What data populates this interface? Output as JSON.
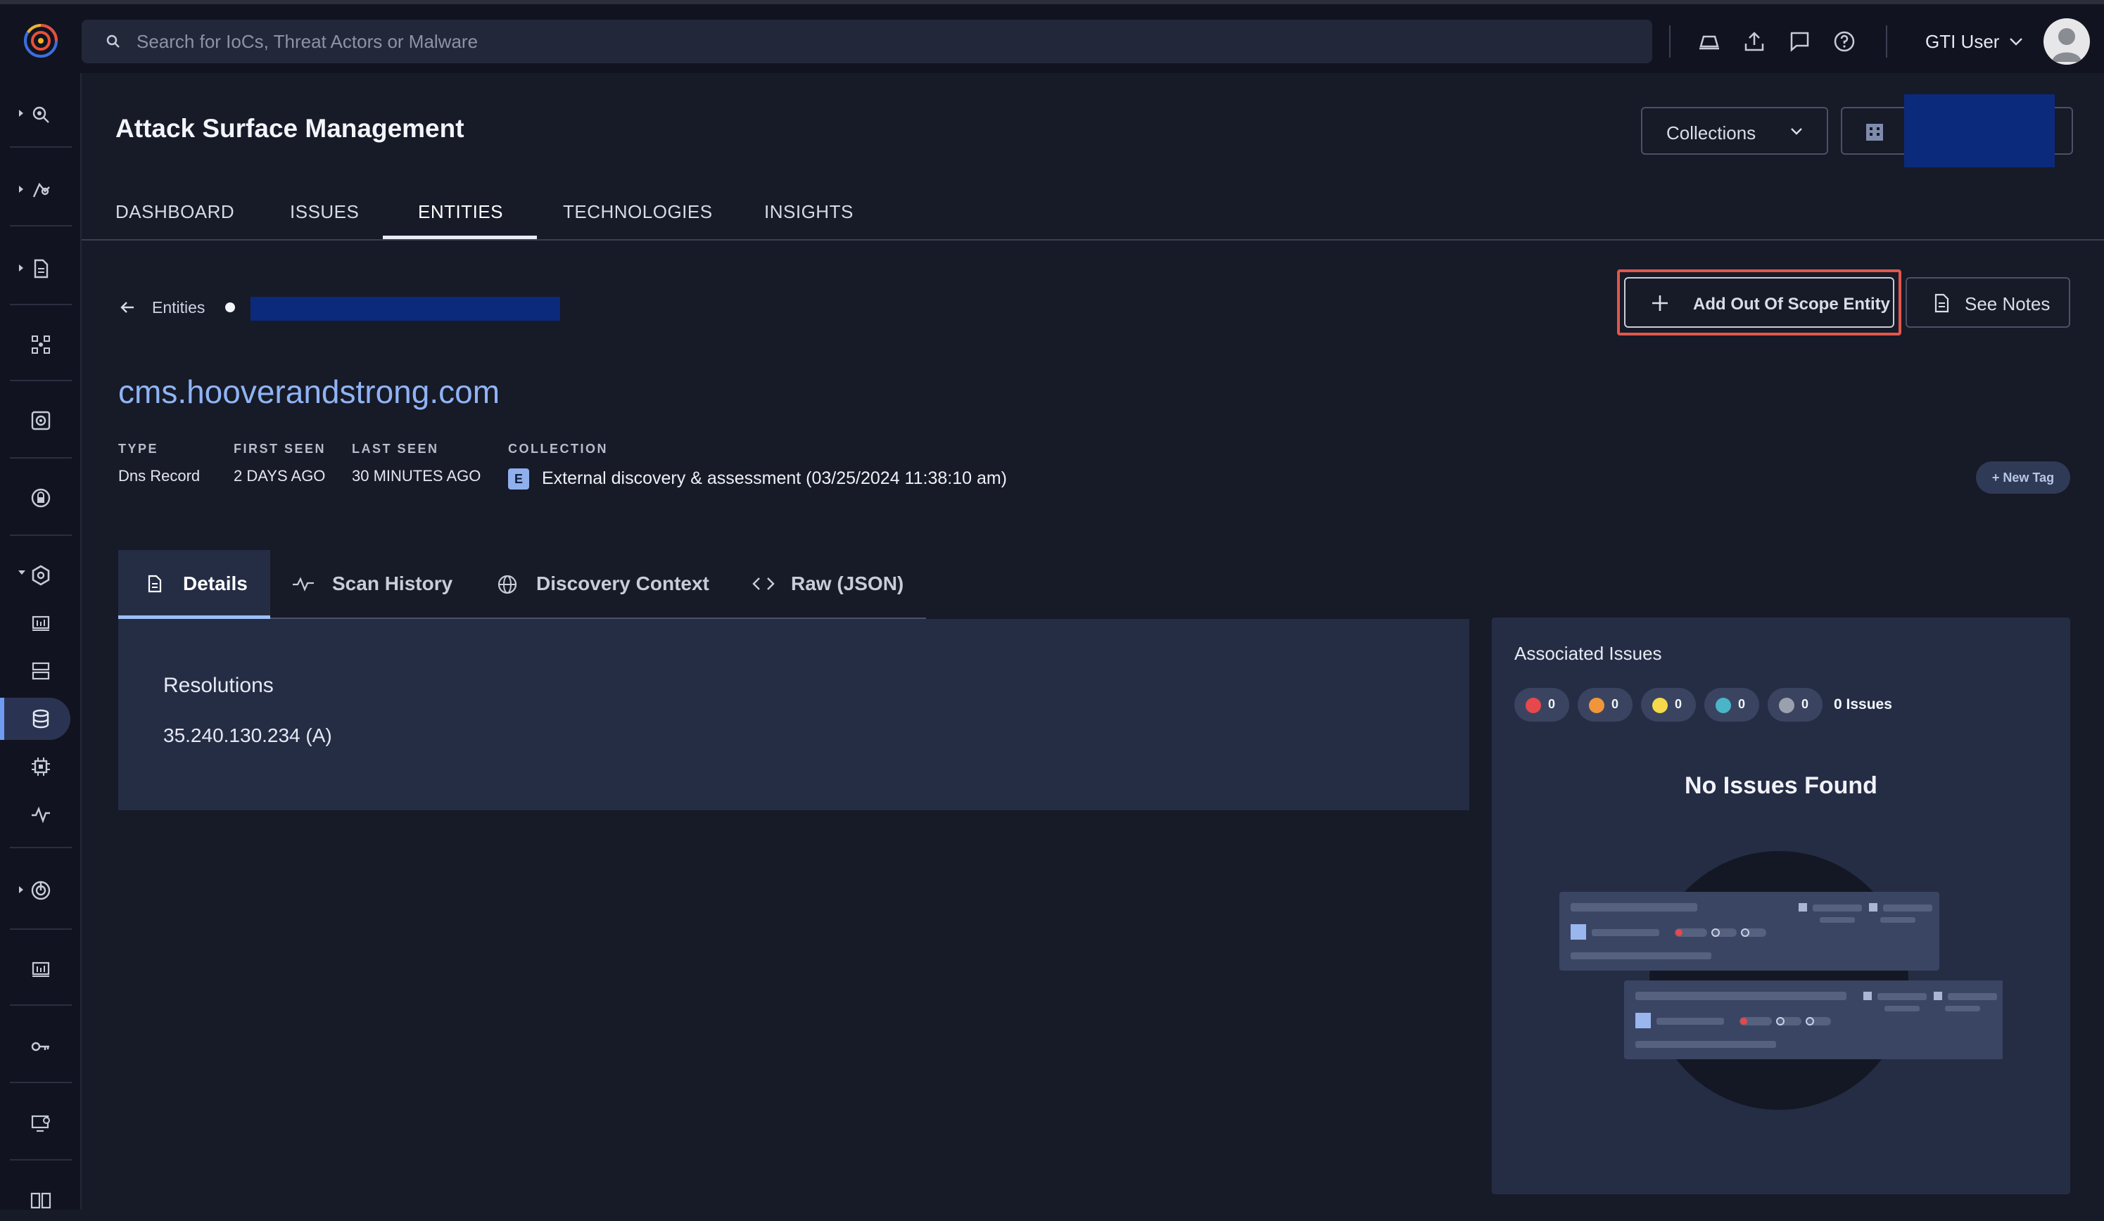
{
  "topbar": {
    "search_placeholder": "Search for IoCs, Threat Actors or Malware",
    "user_name": "GTI User"
  },
  "header": {
    "title": "Attack Surface Management",
    "collections_label": "Collections"
  },
  "main_tabs": [
    "DASHBOARD",
    "ISSUES",
    "ENTITIES",
    "TECHNOLOGIES",
    "INSIGHTS"
  ],
  "breadcrumb": {
    "parent": "Entities"
  },
  "actions": {
    "add_scope": "Add Out Of Scope Entity",
    "see_notes": "See Notes",
    "new_tag": "+ New Tag"
  },
  "entity": {
    "name": "cms.hooverandstrong.com",
    "type_label": "TYPE",
    "type_value": "Dns Record",
    "first_seen_label": "FIRST SEEN",
    "first_seen_value": "2 DAYS AGO",
    "last_seen_label": "LAST SEEN",
    "last_seen_value": "30 MINUTES AGO",
    "collection_label": "COLLECTION",
    "collection_badge": "E",
    "collection_value": "External discovery & assessment (03/25/2024 11:38:10 am)"
  },
  "sub_tabs": [
    "Details",
    "Scan History",
    "Discovery Context",
    "Raw (JSON)"
  ],
  "details": {
    "resolutions_title": "Resolutions",
    "resolution_value": "35.240.130.234 (A)"
  },
  "issues": {
    "title": "Associated Issues",
    "severity_counts": [
      {
        "color": "#e5484d",
        "count": "0"
      },
      {
        "color": "#f0953a",
        "count": "0"
      },
      {
        "color": "#f5d94a",
        "count": "0"
      },
      {
        "color": "#4ab4c9",
        "count": "0"
      },
      {
        "color": "#9aa0ad",
        "count": "0"
      }
    ],
    "total": "0 Issues",
    "empty_message": "No Issues Found"
  },
  "colors": {
    "background": "#171a27",
    "panel": "#252d45",
    "accent_link": "#8fb4f5",
    "highlight": "#e1574c"
  }
}
